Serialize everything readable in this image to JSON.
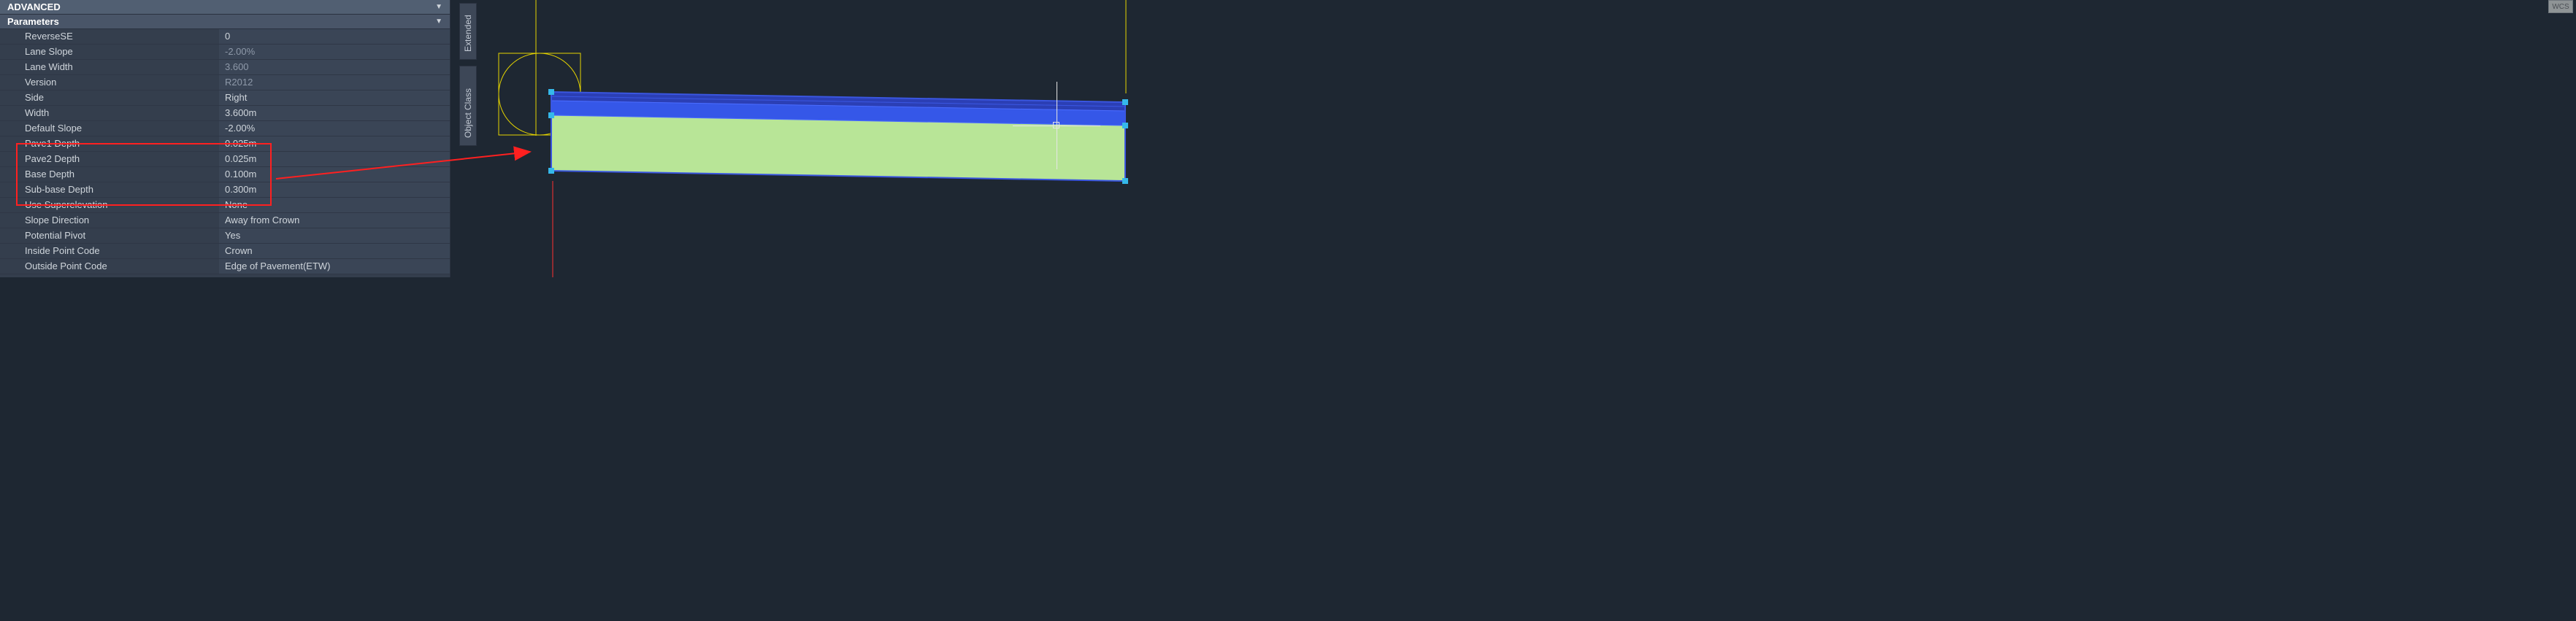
{
  "sections": {
    "advanced": "ADVANCED",
    "parameters": "Parameters"
  },
  "params": [
    {
      "label": "ReverseSE",
      "value": "0",
      "dim": false
    },
    {
      "label": "Lane Slope",
      "value": "-2.00%",
      "dim": true
    },
    {
      "label": "Lane Width",
      "value": "3.600",
      "dim": true
    },
    {
      "label": "Version",
      "value": "R2012",
      "dim": true
    },
    {
      "label": "Side",
      "value": "Right",
      "dim": false
    },
    {
      "label": "Width",
      "value": "3.600m",
      "dim": false
    },
    {
      "label": "Default Slope",
      "value": "-2.00%",
      "dim": false
    },
    {
      "label": "Pave1 Depth",
      "value": "0.025m",
      "dim": false
    },
    {
      "label": "Pave2 Depth",
      "value": "0.025m",
      "dim": false
    },
    {
      "label": "Base Depth",
      "value": "0.100m",
      "dim": false
    },
    {
      "label": "Sub-base Depth",
      "value": "0.300m",
      "dim": false
    },
    {
      "label": "Use Superelevation",
      "value": "None",
      "dim": false
    },
    {
      "label": "Slope Direction",
      "value": "Away from Crown",
      "dim": false
    },
    {
      "label": "Potential Pivot",
      "value": "Yes",
      "dim": false
    },
    {
      "label": "Inside Point Code",
      "value": "Crown",
      "dim": false
    },
    {
      "label": "Outside Point Code",
      "value": "Edge of Pavement(ETW)",
      "dim": false
    }
  ],
  "tabs": {
    "extended": "Extended",
    "objectclass": "Object Class"
  },
  "wcs": "WCS"
}
